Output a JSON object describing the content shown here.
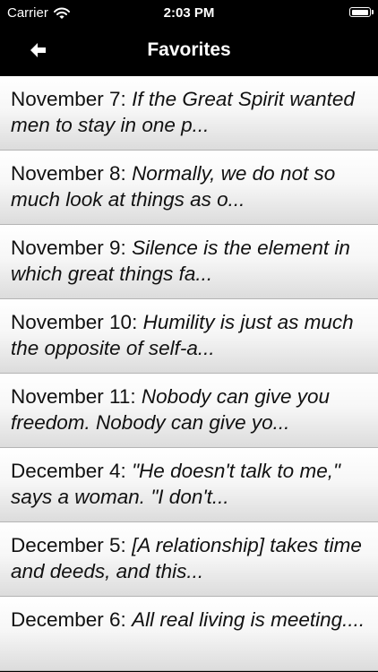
{
  "status_bar": {
    "carrier": "Carrier",
    "time": "2:03 PM",
    "battery_level": 1.0,
    "wifi_icon": "wifi-icon",
    "battery_icon": "battery-icon"
  },
  "nav_bar": {
    "title": "Favorites",
    "back_icon": "arrow-left-icon"
  },
  "favorites": [
    {
      "date": "November 7: ",
      "quote": "If the Great Spirit wanted men to stay in one p..."
    },
    {
      "date": "November 8: ",
      "quote": "Normally, we do not so much look at things as o..."
    },
    {
      "date": "November 9: ",
      "quote": "Silence is the element in which great things fa..."
    },
    {
      "date": "November 10: ",
      "quote": "Humility is just as much the opposite of self-a..."
    },
    {
      "date": "November 11: ",
      "quote": "Nobody can give you freedom. Nobody can give yo..."
    },
    {
      "date": "December 4: ",
      "quote": "\"He doesn't talk to me,\" says a woman. \"I don't..."
    },
    {
      "date": "December 5: ",
      "quote": "[A relationship] takes time and deeds, and this..."
    },
    {
      "date": "December 6: ",
      "quote": "All real living is meeting...."
    }
  ],
  "colors": {
    "bar_background": "#000000",
    "bar_text": "#ffffff",
    "row_gradient_top": "#ffffff",
    "row_gradient_bottom": "#dcdcdc",
    "row_text": "#111111",
    "separator": "#b4b4b4"
  }
}
